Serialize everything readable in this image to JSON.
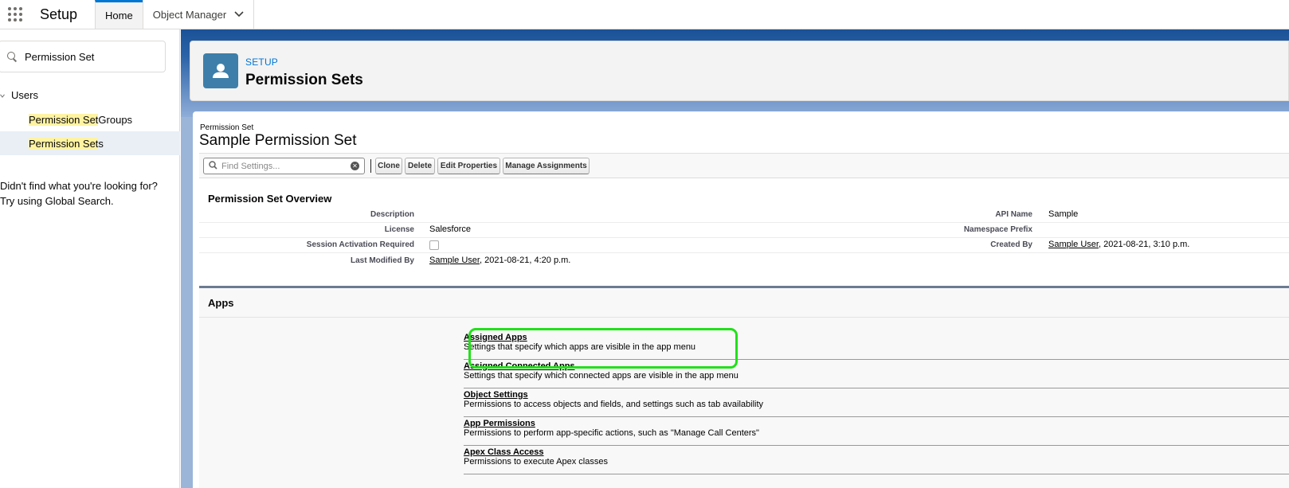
{
  "topbar": {
    "app_title": "Setup",
    "tabs": [
      {
        "label": "Home",
        "active": true
      },
      {
        "label": "Object Manager",
        "active": false
      }
    ]
  },
  "sidebar": {
    "quickfind_value": "Permission Set",
    "tree_root": "Users",
    "items": [
      {
        "highlight": "Permission Set",
        "rest": " Groups"
      },
      {
        "highlight": "Permission Set",
        "rest": "s",
        "selected": true
      }
    ],
    "not_found_line1": "Didn't find what you're looking for?",
    "not_found_line2": "Try using Global Search."
  },
  "header": {
    "eyebrow": "SETUP",
    "title": "Permission Sets",
    "icon": "user-icon"
  },
  "record": {
    "type_label": "Permission Set",
    "name": "Sample Permission Set"
  },
  "toolbar": {
    "find_placeholder": "Find Settings...",
    "buttons": [
      "Clone",
      "Delete",
      "Edit Properties",
      "Manage Assignments"
    ]
  },
  "overview": {
    "title": "Permission Set Overview",
    "left": [
      {
        "label": "Description",
        "value": ""
      },
      {
        "label": "License",
        "value": "Salesforce"
      },
      {
        "label": "Session Activation Required",
        "checkbox": false
      },
      {
        "label": "Last Modified By",
        "user": "Sample User",
        "value": ", 2021-08-21, 4:20 p.m."
      }
    ],
    "right": [
      {
        "label": "API Name",
        "value": "Sample"
      },
      {
        "label": "Namespace Prefix",
        "value": ""
      },
      {
        "label": "Created By",
        "user": "Sample User",
        "value": ", 2021-08-21, 3:10 p.m."
      }
    ]
  },
  "apps": {
    "title": "Apps",
    "items": [
      {
        "link": "Assigned Apps",
        "desc": "Settings that specify which apps are visible in the app menu"
      },
      {
        "link": "Assigned Connected Apps",
        "desc": "Settings that specify which connected apps are visible in the app menu"
      },
      {
        "link": "Object Settings",
        "desc": "Permissions to access objects and fields, and settings such as tab availability"
      },
      {
        "link": "App Permissions",
        "desc": "Permissions to perform app-specific actions, such as \"Manage Call Centers\""
      },
      {
        "link": "Apex Class Access",
        "desc": "Permissions to execute Apex classes"
      }
    ]
  },
  "colors": {
    "highlight_outline": "#22e01a",
    "brand_blue": "#0176d3",
    "header_icon_bg": "#3d7faa",
    "search_highlight": "#fff3a2"
  }
}
